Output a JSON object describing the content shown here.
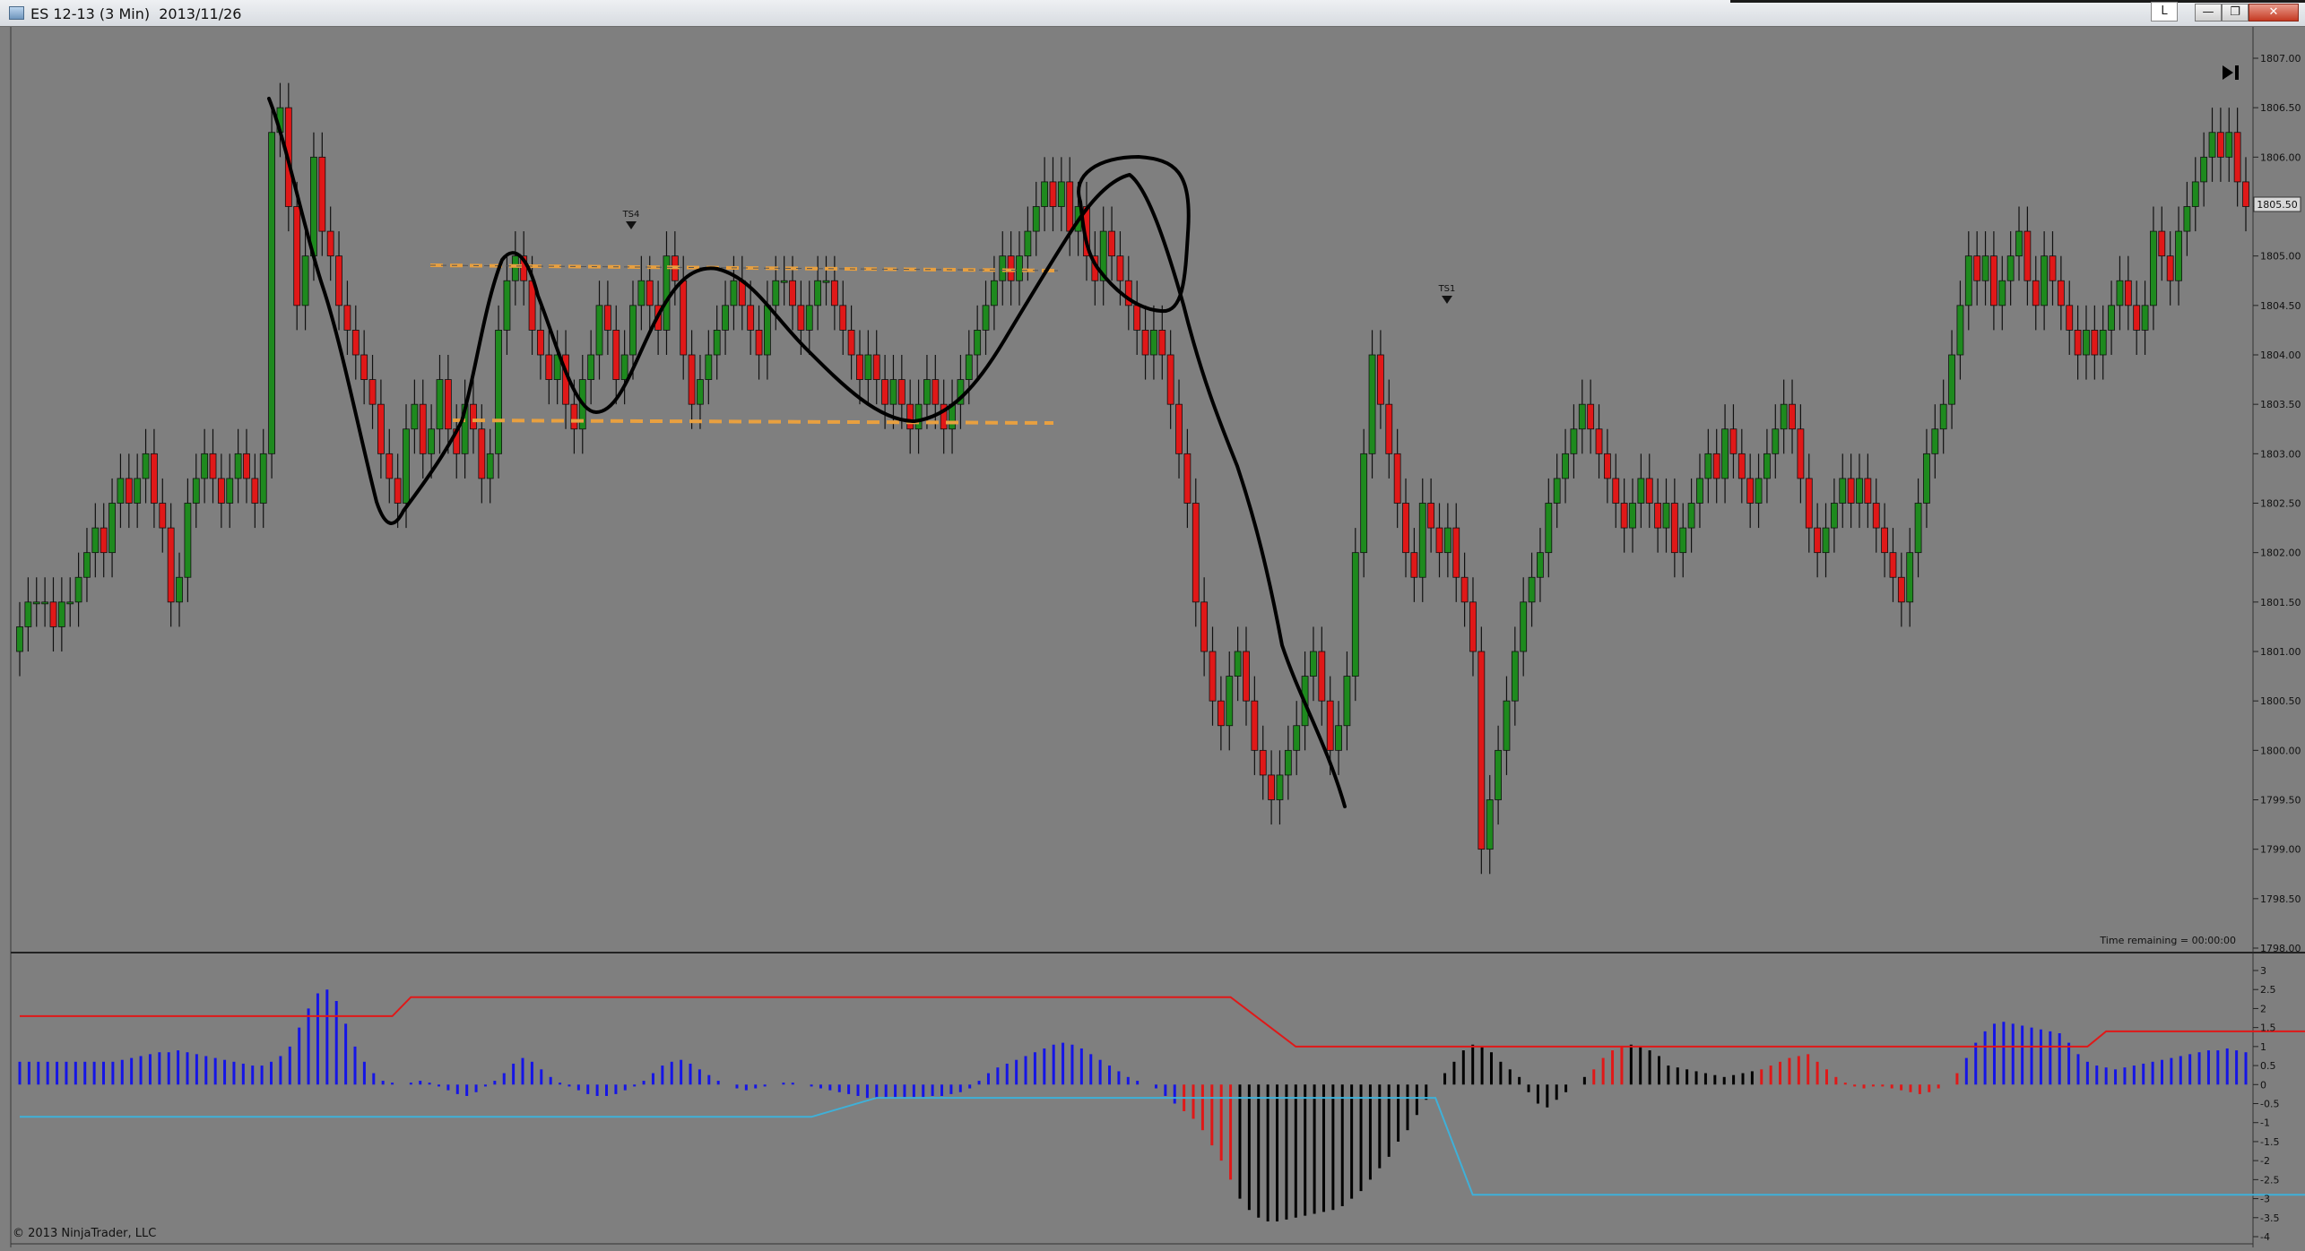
{
  "window": {
    "title": "ES 12-13 (3 Min)  2013/11/26",
    "lock_label": "L",
    "minimize_label": "—",
    "restore_label": "❐",
    "close_label": "✕"
  },
  "price_panel": {
    "y_ticks": [
      "1807.00",
      "1806.50",
      "1806.00",
      "1805.50",
      "1805.00",
      "1804.50",
      "1804.00",
      "1803.50",
      "1803.00",
      "1802.50",
      "1802.00",
      "1801.50",
      "1801.00",
      "1800.50",
      "1800.00",
      "1799.50",
      "1799.00",
      "1798.50",
      "1798.00"
    ],
    "last_price_tag": "1805.50",
    "marker_labels": [
      "TS4",
      "TS1"
    ],
    "time_remaining": "Time remaining = 00:00:00"
  },
  "indicator_panel": {
    "y_ticks": [
      "3",
      "2.5",
      "2",
      "1.5",
      "1",
      "0.5",
      "0",
      "-0.5",
      "-1",
      "-1.5",
      "-2",
      "-2.5",
      "-3",
      "-3.5",
      "-4"
    ]
  },
  "copyright": "© 2013 NinjaTrader, LLC",
  "colors": {
    "background": "#7f7f7f",
    "up_candle": "#1e8a1e",
    "down_candle": "#e01818",
    "histogram_blue": "#1515e6",
    "histogram_black": "#000000",
    "histogram_red": "#e01818",
    "upper_line": "#e01818",
    "lower_line": "#3fb0d8",
    "range_lines": "#e8a040",
    "annotation": "#000000"
  },
  "icons": {
    "go_to_end": "go-to-end-icon",
    "app": "chart-app-icon"
  },
  "chart_data": [
    {
      "type": "candlestick",
      "symbol": "ES 12-13",
      "interval": "3 Min",
      "date": "2013/11/26",
      "ylim": [
        1798.0,
        1807.0
      ],
      "grid": false,
      "closes": [
        1801.25,
        1801.5,
        1801.5,
        1801.5,
        1801.25,
        1801.5,
        1801.5,
        1801.75,
        1802.0,
        1802.25,
        1802.0,
        1802.5,
        1802.75,
        1802.5,
        1802.75,
        1803.0,
        1802.5,
        1802.25,
        1801.5,
        1801.75,
        1802.5,
        1802.75,
        1803.0,
        1802.75,
        1802.5,
        1802.75,
        1803.0,
        1802.75,
        1802.5,
        1803.0,
        1806.25,
        1806.5,
        1805.5,
        1804.5,
        1805.0,
        1806.0,
        1805.25,
        1805.0,
        1804.5,
        1804.25,
        1804.0,
        1803.75,
        1803.5,
        1803.0,
        1802.75,
        1802.5,
        1803.25,
        1803.5,
        1803.0,
        1803.25,
        1803.75,
        1803.25,
        1803.0,
        1803.5,
        1803.25,
        1802.75,
        1803.0,
        1804.25,
        1804.75,
        1805.0,
        1804.75,
        1804.25,
        1804.0,
        1803.75,
        1804.0,
        1803.5,
        1803.25,
        1803.75,
        1804.0,
        1804.5,
        1804.25,
        1803.75,
        1804.0,
        1804.5,
        1804.75,
        1804.5,
        1804.25,
        1805.0,
        1804.75,
        1804.0,
        1803.5,
        1803.75,
        1804.0,
        1804.25,
        1804.5,
        1804.75,
        1804.5,
        1804.25,
        1804.0,
        1804.5,
        1804.75,
        1804.75,
        1804.5,
        1804.25,
        1804.5,
        1804.75,
        1804.75,
        1804.5,
        1804.25,
        1804.0,
        1803.75,
        1804.0,
        1803.75,
        1803.5,
        1803.75,
        1803.5,
        1803.25,
        1803.5,
        1803.75,
        1803.5,
        1803.25,
        1803.5,
        1803.75,
        1804.0,
        1804.25,
        1804.5,
        1804.75,
        1805.0,
        1804.75,
        1805.0,
        1805.25,
        1805.5,
        1805.75,
        1805.5,
        1805.75,
        1805.25,
        1805.5,
        1805.0,
        1804.75,
        1805.25,
        1805.0,
        1804.75,
        1804.5,
        1804.25,
        1804.0,
        1804.25,
        1804.0,
        1803.5,
        1803.0,
        1802.5,
        1801.5,
        1801.0,
        1800.5,
        1800.25,
        1800.75,
        1801.0,
        1800.5,
        1800.0,
        1799.75,
        1799.5,
        1799.75,
        1800.0,
        1800.25,
        1800.75,
        1801.0,
        1800.5,
        1800.0,
        1800.25,
        1800.75,
        1802.0,
        1803.0,
        1804.0,
        1803.5,
        1803.0,
        1802.5,
        1802.0,
        1801.75,
        1802.5,
        1802.25,
        1802.0,
        1802.25,
        1801.75,
        1801.5,
        1801.0,
        1799.0,
        1799.5,
        1800.0,
        1800.5,
        1801.0,
        1801.5,
        1801.75,
        1802.0,
        1802.5,
        1802.75,
        1803.0,
        1803.25,
        1803.5,
        1803.25,
        1803.0,
        1802.75,
        1802.5,
        1802.25,
        1802.5,
        1802.75,
        1802.5,
        1802.25,
        1802.5,
        1802.0,
        1802.25,
        1802.5,
        1802.75,
        1803.0,
        1802.75,
        1803.25,
        1803.0,
        1802.75,
        1802.5,
        1802.75,
        1803.0,
        1803.25,
        1803.5,
        1803.25,
        1802.75,
        1802.25,
        1802.0,
        1802.25,
        1802.5,
        1802.75,
        1802.5,
        1802.75,
        1802.5,
        1802.25,
        1802.0,
        1801.75,
        1801.5,
        1802.0,
        1802.5,
        1803.0,
        1803.25,
        1803.5,
        1804.0,
        1804.5,
        1805.0,
        1804.75,
        1805.0,
        1804.5,
        1804.75,
        1805.0,
        1805.25,
        1804.75,
        1804.5,
        1805.0,
        1804.75,
        1804.5,
        1804.25,
        1804.0,
        1804.25,
        1804.0,
        1804.25,
        1804.5,
        1804.75,
        1804.5,
        1804.25,
        1804.5,
        1805.25,
        1805.0,
        1804.75,
        1805.25,
        1805.5,
        1805.75,
        1806.0,
        1806.25,
        1806.0,
        1806.25,
        1805.75,
        1805.5
      ]
    },
    {
      "type": "bar",
      "name": "oscillator histogram",
      "ylim": [
        -4,
        3
      ],
      "values": [
        0.6,
        0.6,
        0.6,
        0.6,
        0.6,
        0.6,
        0.6,
        0.6,
        0.6,
        0.6,
        0.6,
        0.65,
        0.7,
        0.75,
        0.8,
        0.85,
        0.85,
        0.9,
        0.85,
        0.8,
        0.75,
        0.7,
        0.65,
        0.6,
        0.55,
        0.5,
        0.5,
        0.6,
        0.75,
        1.0,
        1.5,
        2.0,
        2.4,
        2.5,
        2.2,
        1.6,
        1.0,
        0.6,
        0.3,
        0.1,
        0.05,
        0.0,
        0.05,
        0.1,
        0.05,
        -0.05,
        -0.15,
        -0.25,
        -0.3,
        -0.2,
        -0.05,
        0.1,
        0.3,
        0.55,
        0.7,
        0.6,
        0.4,
        0.2,
        0.05,
        -0.05,
        -0.15,
        -0.25,
        -0.3,
        -0.3,
        -0.25,
        -0.15,
        -0.05,
        0.1,
        0.3,
        0.5,
        0.6,
        0.65,
        0.55,
        0.4,
        0.25,
        0.1,
        0.0,
        -0.1,
        -0.15,
        -0.1,
        -0.05,
        0.0,
        0.05,
        0.05,
        0.0,
        -0.05,
        -0.1,
        -0.15,
        -0.2,
        -0.25,
        -0.3,
        -0.35,
        -0.35,
        -0.35,
        -0.35,
        -0.35,
        -0.35,
        -0.35,
        -0.3,
        -0.3,
        -0.25,
        -0.2,
        -0.1,
        0.1,
        0.3,
        0.45,
        0.55,
        0.65,
        0.75,
        0.85,
        0.95,
        1.05,
        1.1,
        1.05,
        0.95,
        0.8,
        0.65,
        0.5,
        0.35,
        0.2,
        0.1,
        0.0,
        -0.1,
        -0.3,
        -0.5,
        -0.7,
        -0.9,
        -1.2,
        -1.6,
        -2.0,
        -2.5,
        -3.0,
        -3.3,
        -3.5,
        -3.6,
        -3.6,
        -3.55,
        -3.5,
        -3.45,
        -3.4,
        -3.35,
        -3.3,
        -3.2,
        -3.0,
        -2.8,
        -2.5,
        -2.2,
        -1.9,
        -1.5,
        -1.2,
        -0.8,
        -0.4,
        0.0,
        0.3,
        0.6,
        0.9,
        1.05,
        1.0,
        0.85,
        0.6,
        0.4,
        0.2,
        -0.2,
        -0.5,
        -0.6,
        -0.4,
        -0.2,
        0.0,
        0.2,
        0.4,
        0.7,
        0.9,
        1.0,
        1.05,
        1.0,
        0.9,
        0.75,
        0.5,
        0.45,
        0.4,
        0.35,
        0.3,
        0.25,
        0.2,
        0.25,
        0.3,
        0.35,
        0.4,
        0.5,
        0.6,
        0.7,
        0.75,
        0.8,
        0.6,
        0.4,
        0.2,
        0.05,
        -0.05,
        -0.1,
        -0.05,
        -0.05,
        -0.1,
        -0.15,
        -0.2,
        -0.25,
        -0.2,
        -0.1,
        0.0,
        0.3,
        0.7,
        1.1,
        1.4,
        1.6,
        1.65,
        1.6,
        1.55,
        1.5,
        1.45,
        1.4,
        1.35,
        1.1,
        0.8,
        0.6,
        0.5,
        0.45,
        0.4,
        0.45,
        0.5,
        0.55,
        0.6,
        0.65,
        0.7,
        0.75,
        0.8,
        0.85,
        0.9,
        0.9,
        0.95,
        0.9,
        0.85
      ],
      "colors_segments": [
        {
          "from": 0,
          "to": 124,
          "color": "blue"
        },
        {
          "from": 125,
          "to": 130,
          "color": "red"
        },
        {
          "from": 131,
          "to": 150,
          "color": "black"
        },
        {
          "from": 151,
          "to": 168,
          "color": "black"
        },
        {
          "from": 169,
          "to": 172,
          "color": "red"
        },
        {
          "from": 173,
          "to": 186,
          "color": "black"
        },
        {
          "from": 187,
          "to": 208,
          "color": "red"
        },
        {
          "from": 209,
          "to": 264,
          "color": "blue"
        }
      ],
      "upper_line": [
        {
          "i": 0,
          "v": 1.8
        },
        {
          "i": 40,
          "v": 1.8
        },
        {
          "i": 42,
          "v": 2.3
        },
        {
          "i": 130,
          "v": 2.3
        },
        {
          "i": 137,
          "v": 1.0
        },
        {
          "i": 222,
          "v": 1.0
        },
        {
          "i": 224,
          "v": 1.4
        },
        {
          "i": 264,
          "v": 1.4
        }
      ],
      "lower_line": [
        {
          "i": 0,
          "v": -0.85
        },
        {
          "i": 85,
          "v": -0.85
        },
        {
          "i": 92,
          "v": -0.35
        },
        {
          "i": 152,
          "v": -0.35
        },
        {
          "i": 156,
          "v": -2.9
        },
        {
          "i": 258,
          "v": -2.9
        },
        {
          "i": 264,
          "v": -2.6
        }
      ]
    }
  ]
}
